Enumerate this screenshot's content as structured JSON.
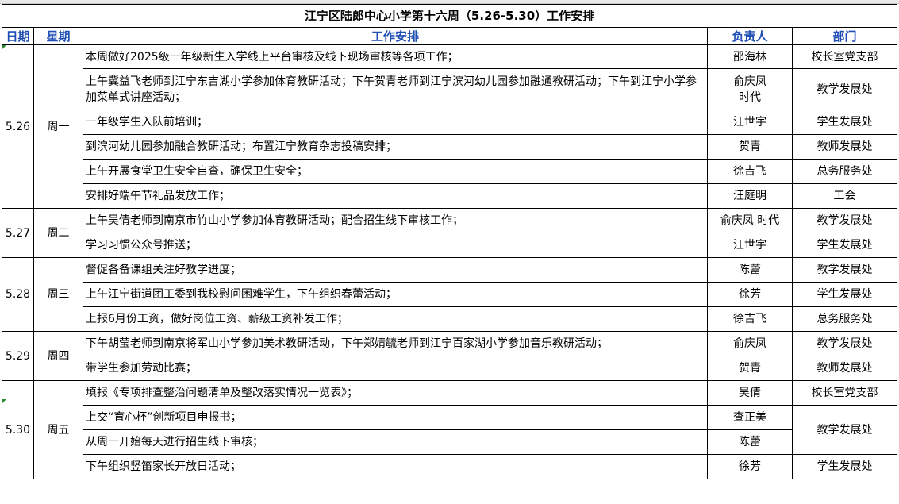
{
  "title": "江宁区陆郎中心小学第十六周（5.26-5.30）工作安排",
  "headers": {
    "date": "日期",
    "weekday": "星期",
    "task": "工作安排",
    "owner": "负责人",
    "dept": "部门"
  },
  "days": [
    {
      "date": "5.26",
      "weekday": "周一",
      "rows": [
        {
          "task": "本周做好2025级一年级新生入学线上平台审核及线下现场审核等各项工作；",
          "owner": "邵海林",
          "dept": "校长室党支部"
        },
        {
          "task": "上午冀益飞老师到江宁东吉湖小学参加体育教研活动；下午贺青老师到江宁滨河幼儿园参加融通教研活动；下午到江宁小学参加菜单式讲座活动；",
          "owner": "俞庆凤\n时代",
          "dept": "教学发展处"
        },
        {
          "task": "一年级学生入队前培训；",
          "owner": "汪世宇",
          "dept": "学生发展处"
        },
        {
          "task": "到滨河幼儿园参加融合教研活动；布置江宁教育杂志投稿安排；",
          "owner": "贺青",
          "dept": "教师发展处"
        },
        {
          "task": "上午开展食堂卫生安全自查，确保卫生安全；",
          "owner": "徐吉飞",
          "dept": "总务服务处"
        },
        {
          "task": "安排好端午节礼品发放工作；",
          "owner": "汪庭明",
          "dept": "工会"
        }
      ]
    },
    {
      "date": "5.27",
      "weekday": "周二",
      "rows": [
        {
          "task": "上午吴倩老师到南京市竹山小学参加体育教研活动；配合招生线下审核工作；",
          "owner": "俞庆凤 时代",
          "dept": "教学发展处"
        },
        {
          "task": "学习习惯公众号推送；",
          "owner": "汪世宇",
          "dept": "学生发展处"
        }
      ]
    },
    {
      "date": "5.28",
      "weekday": "周三",
      "rows": [
        {
          "task": "督促各备课组关注好教学进度；",
          "owner": "陈蕾",
          "dept": "教学发展处"
        },
        {
          "task": "上午江宁街道团工委到我校慰问困难学生，下午组织春蕾活动；",
          "owner": "徐芳",
          "dept": "学生发展处"
        },
        {
          "task": "上报6月份工资，做好岗位工资、薪级工资补发工作；",
          "owner": "徐吉飞",
          "dept": "总务服务处"
        }
      ]
    },
    {
      "date": "5.29",
      "weekday": "周四",
      "rows": [
        {
          "task": "下午胡莹老师到南京将军山小学参加美术教研活动，下午郑婧毓老师到江宁百家湖小学参加音乐教研活动；",
          "owner": "俞庆凤",
          "dept": "教学发展处"
        },
        {
          "task": "带学生参加劳动比赛；",
          "owner": "贺青",
          "dept": "教师发展处"
        }
      ]
    },
    {
      "date": "5.30",
      "weekday": "周五",
      "rows": [
        {
          "task": "填报《专项排查整治问题清单及整改落实情况一览表》；",
          "owner": "吴倩",
          "dept": "校长室党支部"
        },
        {
          "task": "上交“育心杯”创新项目申报书；",
          "owner": "查正美",
          "dept": "教学发展处"
        },
        {
          "task": "从周一开始每天进行招生线下审核；",
          "owner": "陈蕾",
          "dept": null
        },
        {
          "task": "下午组织竖笛家长开放日活动；",
          "owner": "徐芳",
          "dept": "学生发展处"
        }
      ]
    }
  ]
}
